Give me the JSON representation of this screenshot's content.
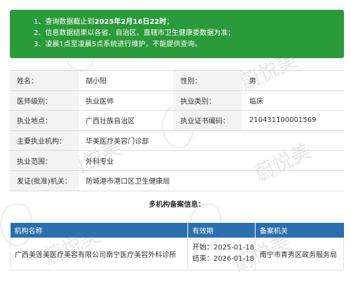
{
  "notice": {
    "line1_prefix": "1、查询数据截止到",
    "line1_date": "2025年2月16日22时",
    "line1_suffix": "；",
    "line2": "2、信息数据结果以各省、自治区、直辖市卫生健康委数据为准；",
    "line3": "3、凌晨1点至凌晨5点系统进行维护，不能提供查询。"
  },
  "info": {
    "name_label": "姓名：",
    "name_value": "胡小阳",
    "gender_label": "性别：",
    "gender_value": "男",
    "level_label": "医师级别：",
    "level_value": "执业医师",
    "category_label": "执业类别：",
    "category_value": "临床",
    "place_label": "执业地点：",
    "place_value": "广西壮族自治区",
    "cert_label": "执业证书编码：",
    "cert_value": "210431100001569",
    "org_label": "主要执业机构：",
    "org_value": "华美医疗美容门诊部",
    "scope_label": "执业范围：",
    "scope_value": "外科专业",
    "issuer_label": "发证(批准)机关：",
    "issuer_value": "防城港市港口区卫生健康局"
  },
  "multi": {
    "title": "多机构备案信息：",
    "headers": [
      "机构名称",
      "有效期",
      "备案机关"
    ],
    "rows": [
      {
        "org": "广西美莲美医疗美容有限公司南宁医疗美容外科诊所",
        "start_label": "开始：",
        "start": "2025-01-18",
        "end_label": "结束：",
        "end": "2026-01-18",
        "authority": "南宁市青秀区政务服务局"
      }
    ]
  },
  "watermark": {
    "text": "蔚悦美",
    "sub": "Bhi kanmei.com"
  }
}
